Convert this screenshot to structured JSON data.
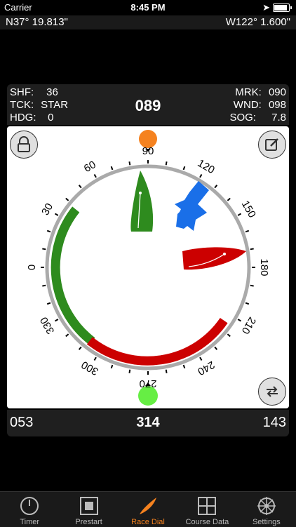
{
  "status_bar": {
    "carrier": "Carrier",
    "time": "8:45 PM"
  },
  "position": {
    "latitude": "N37° 19.813\"",
    "longitude": "W122° 1.600\""
  },
  "info": {
    "shf_label": "SHF:",
    "shf_value": "36",
    "tck_label": "TCK:",
    "tck_value": "STAR",
    "hdg_label": "HDG:",
    "hdg_value": "0",
    "mrk_label": "MRK:",
    "mrk_value": "090",
    "wnd_label": "WND:",
    "wnd_value": "098",
    "sog_label": "SOG:",
    "sog_value": "7.8",
    "heading": "089"
  },
  "dial": {
    "labels": [
      "90",
      "120",
      "150",
      "180",
      "210",
      "240",
      "270",
      "300",
      "330",
      "0",
      "30",
      "60"
    ],
    "colors": {
      "starboard": "#2e8b1e",
      "port": "#cc0000",
      "wind_arrow": "#1a6fe8",
      "top_marker": "#f5821f",
      "bottom_marker": "#66ee44"
    }
  },
  "bottom": {
    "left_value": "053",
    "center_value": "314",
    "right_value": "143"
  },
  "tabs": [
    {
      "label": "Timer",
      "icon": "clock-icon"
    },
    {
      "label": "Prestart",
      "icon": "square-icon"
    },
    {
      "label": "Race Dial",
      "icon": "sail-icon",
      "active": true
    },
    {
      "label": "Course Data",
      "icon": "grid-icon"
    },
    {
      "label": "Settings",
      "icon": "helm-icon"
    }
  ]
}
